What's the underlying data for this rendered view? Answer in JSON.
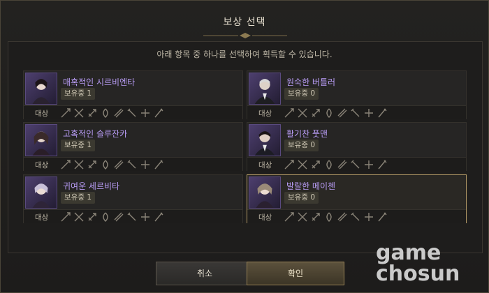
{
  "dialog": {
    "title": "보상 선택",
    "subtitle": "아래 항목 중 하나를 선택하여 획득할 수 있습니다."
  },
  "target_label": "대상",
  "items": [
    {
      "name": "매혹적인 시르비엔타",
      "owned": "보유중 1",
      "selected": false
    },
    {
      "name": "원숙한 버틀러",
      "owned": "보유중 0",
      "selected": false
    },
    {
      "name": "고혹적인 슬루잔카",
      "owned": "보유중 1",
      "selected": false
    },
    {
      "name": "활기찬 풋맨",
      "owned": "보유중 0",
      "selected": false
    },
    {
      "name": "귀여운 세르비타",
      "owned": "보유중 1",
      "selected": false
    },
    {
      "name": "발랄한 메이첸",
      "owned": "보유중 0",
      "selected": true
    }
  ],
  "buttons": {
    "cancel": "취소",
    "confirm": "확인"
  },
  "watermark": {
    "line1": "game",
    "line2": "chosun"
  },
  "colors": {
    "name_text": "#b89cf5",
    "selected_border": "#b39a67"
  }
}
